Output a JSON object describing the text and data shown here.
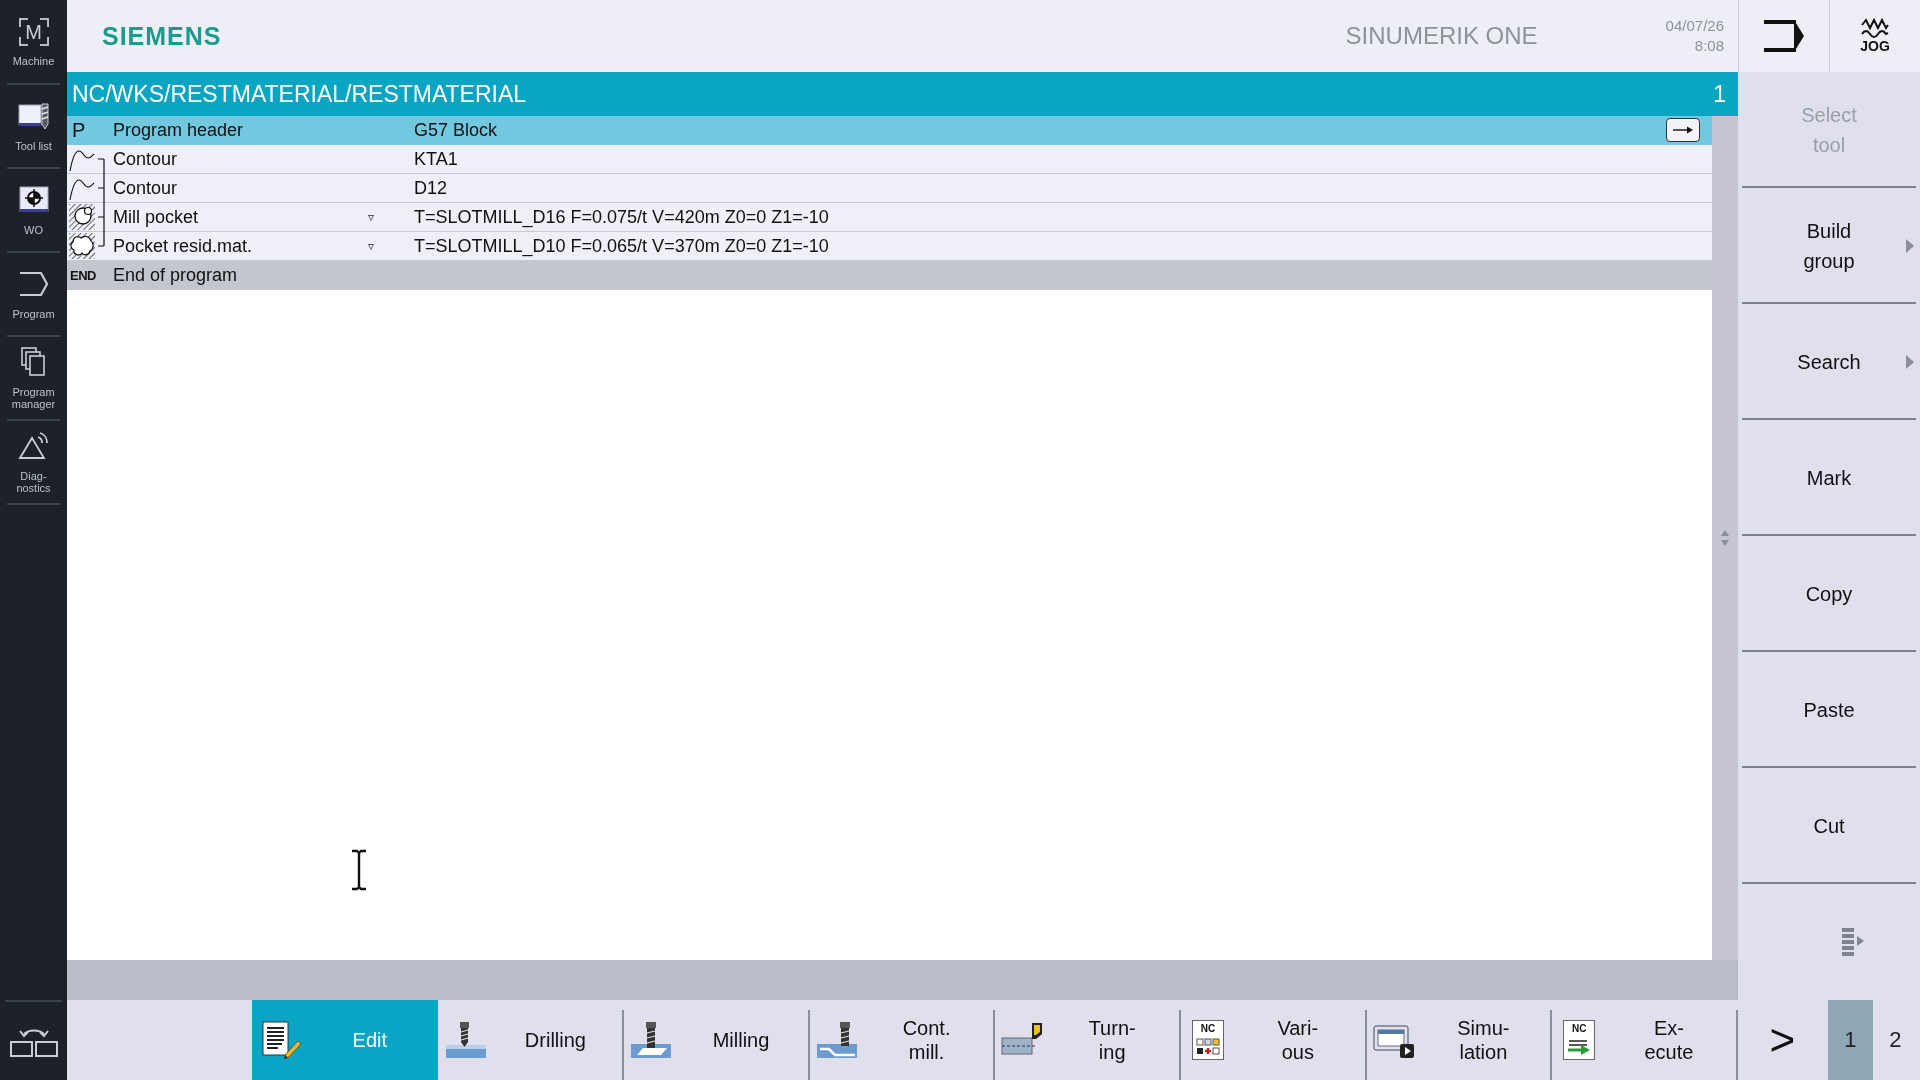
{
  "sidebar": {
    "items": [
      {
        "label": "Machine",
        "icon_text": "M",
        "selected": false
      },
      {
        "label": "Tool list",
        "selected": false
      },
      {
        "label": "WO",
        "selected": false
      },
      {
        "label": "Program",
        "selected": false
      },
      {
        "label": "Program\nmanager",
        "selected": false
      },
      {
        "label": "Diag-\nnostics",
        "selected": false
      }
    ]
  },
  "header": {
    "brand": "SIEMENS",
    "product": "SINUMERIK ONE",
    "date": "04/07/26",
    "time": "8:08",
    "mode_button": {
      "label": "JOG"
    }
  },
  "editor": {
    "title": "NC/WKS/RESTMATERIAL/RESTMATERIAL",
    "number": "1",
    "rows": [
      {
        "kind": "header",
        "marker": "P",
        "name": "Program header",
        "value": "G57 Block",
        "selected": true,
        "linked": false
      },
      {
        "kind": "contour",
        "name": "Contour",
        "value": "KTA1",
        "selected": false,
        "linked": true
      },
      {
        "kind": "contour",
        "name": "Contour",
        "value": "D12",
        "selected": false,
        "linked": true
      },
      {
        "kind": "pocket",
        "name": "Mill pocket",
        "toggle": "▿",
        "value": "T=SLOTMILL_D16 F=0.075/t V=420m Z0=0 Z1=-10",
        "selected": false,
        "linked": true
      },
      {
        "kind": "residual",
        "name": "Pocket resid.mat.",
        "toggle": "▿",
        "value": "T=SLOTMILL_D10 F=0.065/t V=370m Z0=0 Z1=-10",
        "selected": false,
        "linked": true
      },
      {
        "kind": "end",
        "marker": "END",
        "name": "End of program",
        "selected": false,
        "linked": false
      }
    ]
  },
  "softkeys_right": [
    {
      "kind": "text",
      "label": "Select\ntool",
      "disabled": true,
      "submenu": false
    },
    {
      "kind": "text",
      "label": "Build\ngroup",
      "disabled": false,
      "submenu": true
    },
    {
      "kind": "text",
      "label": "Search",
      "disabled": false,
      "submenu": true
    },
    {
      "kind": "text",
      "label": "Mark",
      "disabled": false,
      "submenu": false
    },
    {
      "kind": "text",
      "label": "Copy",
      "disabled": false,
      "submenu": false
    },
    {
      "kind": "text",
      "label": "Paste",
      "disabled": false,
      "submenu": false
    },
    {
      "kind": "text",
      "label": "Cut",
      "disabled": false,
      "submenu": false
    },
    {
      "kind": "icon",
      "disabled": false,
      "submenu": false
    }
  ],
  "softkeys_bottom": [
    {
      "label": "Edit",
      "selected": true
    },
    {
      "label": "Drilling",
      "selected": false
    },
    {
      "label": "Milling",
      "selected": false
    },
    {
      "label": "Cont.\nmill.",
      "selected": false
    },
    {
      "label": "Turn-\ning",
      "selected": false
    },
    {
      "label": "Vari-\nous",
      "icon_text": "NC",
      "selected": false
    },
    {
      "label": "Simu-\nlation",
      "selected": false
    },
    {
      "label": "Ex-\necute",
      "icon_text": "NC",
      "selected": false
    }
  ],
  "pager": {
    "next": ">",
    "pages": [
      {
        "label": "1",
        "selected": true
      },
      {
        "label": "2",
        "selected": false
      }
    ]
  }
}
